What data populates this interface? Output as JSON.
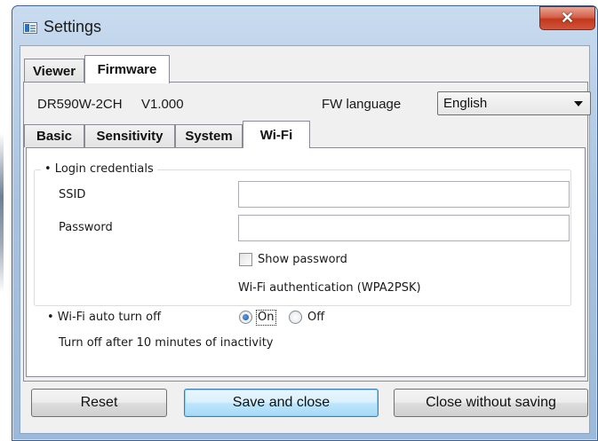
{
  "window": {
    "title": "Settings"
  },
  "top_tabs": [
    {
      "label": "Viewer",
      "active": false
    },
    {
      "label": "Firmware",
      "active": true
    }
  ],
  "device": {
    "model": "DR590W-2CH",
    "version": "V1.000",
    "fw_language_label": "FW language",
    "fw_language_value": "English"
  },
  "sub_tabs": [
    {
      "label": "Basic",
      "active": false
    },
    {
      "label": "Sensitivity",
      "active": false
    },
    {
      "label": "System",
      "active": false
    },
    {
      "label": "Wi-Fi",
      "active": true
    }
  ],
  "login": {
    "legend": "• Login credentials",
    "ssid_label": "SSID",
    "ssid_value": "",
    "password_label": "Password",
    "password_value": "",
    "show_password_label": "Show password",
    "show_password_checked": false,
    "auth_text": "Wi-Fi authentication (WPA2PSK)"
  },
  "auto_off": {
    "label": "• Wi-Fi auto turn off",
    "options": [
      {
        "label": "On",
        "selected": true
      },
      {
        "label": "Off",
        "selected": false
      }
    ],
    "description": "Turn off after 10 minutes of inactivity"
  },
  "buttons": {
    "reset": "Reset",
    "save": "Save and close",
    "close": "Close without saving"
  },
  "colors": {
    "titlebar": "#a8c3e0",
    "close_button": "#c2381c",
    "panel": "#ffffff",
    "dialog": "#f0f0f0",
    "default_button": "#bee6fd"
  }
}
